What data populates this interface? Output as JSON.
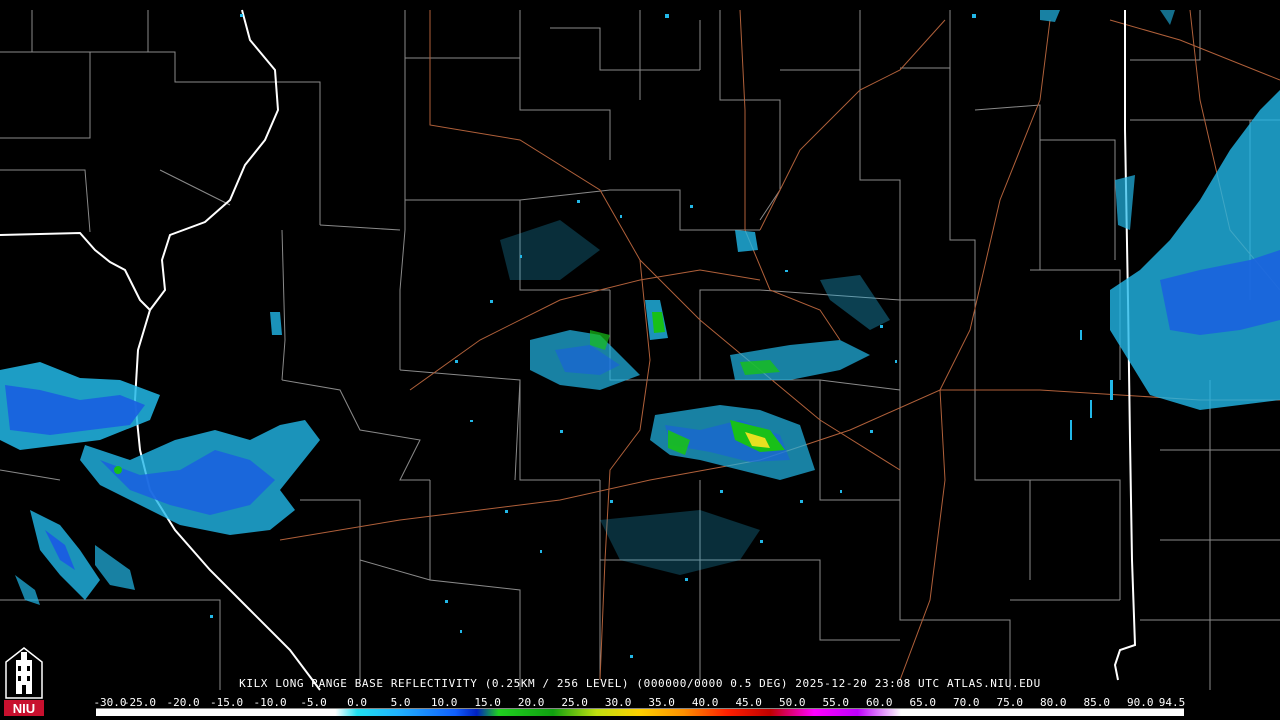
{
  "map": {
    "product_line": "KILX LONG RANGE BASE REFLECTIVITY (0.25KM / 256 LEVEL) (000000/0000 0.5 DEG) 2025-12-20 23:08 UTC  ATLAS.NIU.EDU",
    "colors": {
      "background": "#000000",
      "county_border": "#8a8a8a",
      "state_border": "#ffffff",
      "highway": "#b0603a",
      "echo_light": "#22b8e8",
      "echo_medium": "#1a5fe0",
      "echo_heavy": "#18c018",
      "echo_peak": "#e8e020"
    }
  },
  "colorbar": {
    "labels": [
      "-30.0",
      "-25.0",
      "-20.0",
      "-15.0",
      "-10.0",
      "-5.0",
      "0.0",
      "5.0",
      "10.0",
      "15.0",
      "20.0",
      "25.0",
      "30.0",
      "35.0",
      "40.0",
      "45.0",
      "50.0",
      "55.0",
      "60.0",
      "65.0",
      "70.0",
      "75.0",
      "80.0",
      "85.0",
      "90.0",
      "94.5"
    ],
    "min": -30.0,
    "max": 94.5
  },
  "logo": {
    "text": "NIU",
    "icon": "university-tower-icon"
  }
}
